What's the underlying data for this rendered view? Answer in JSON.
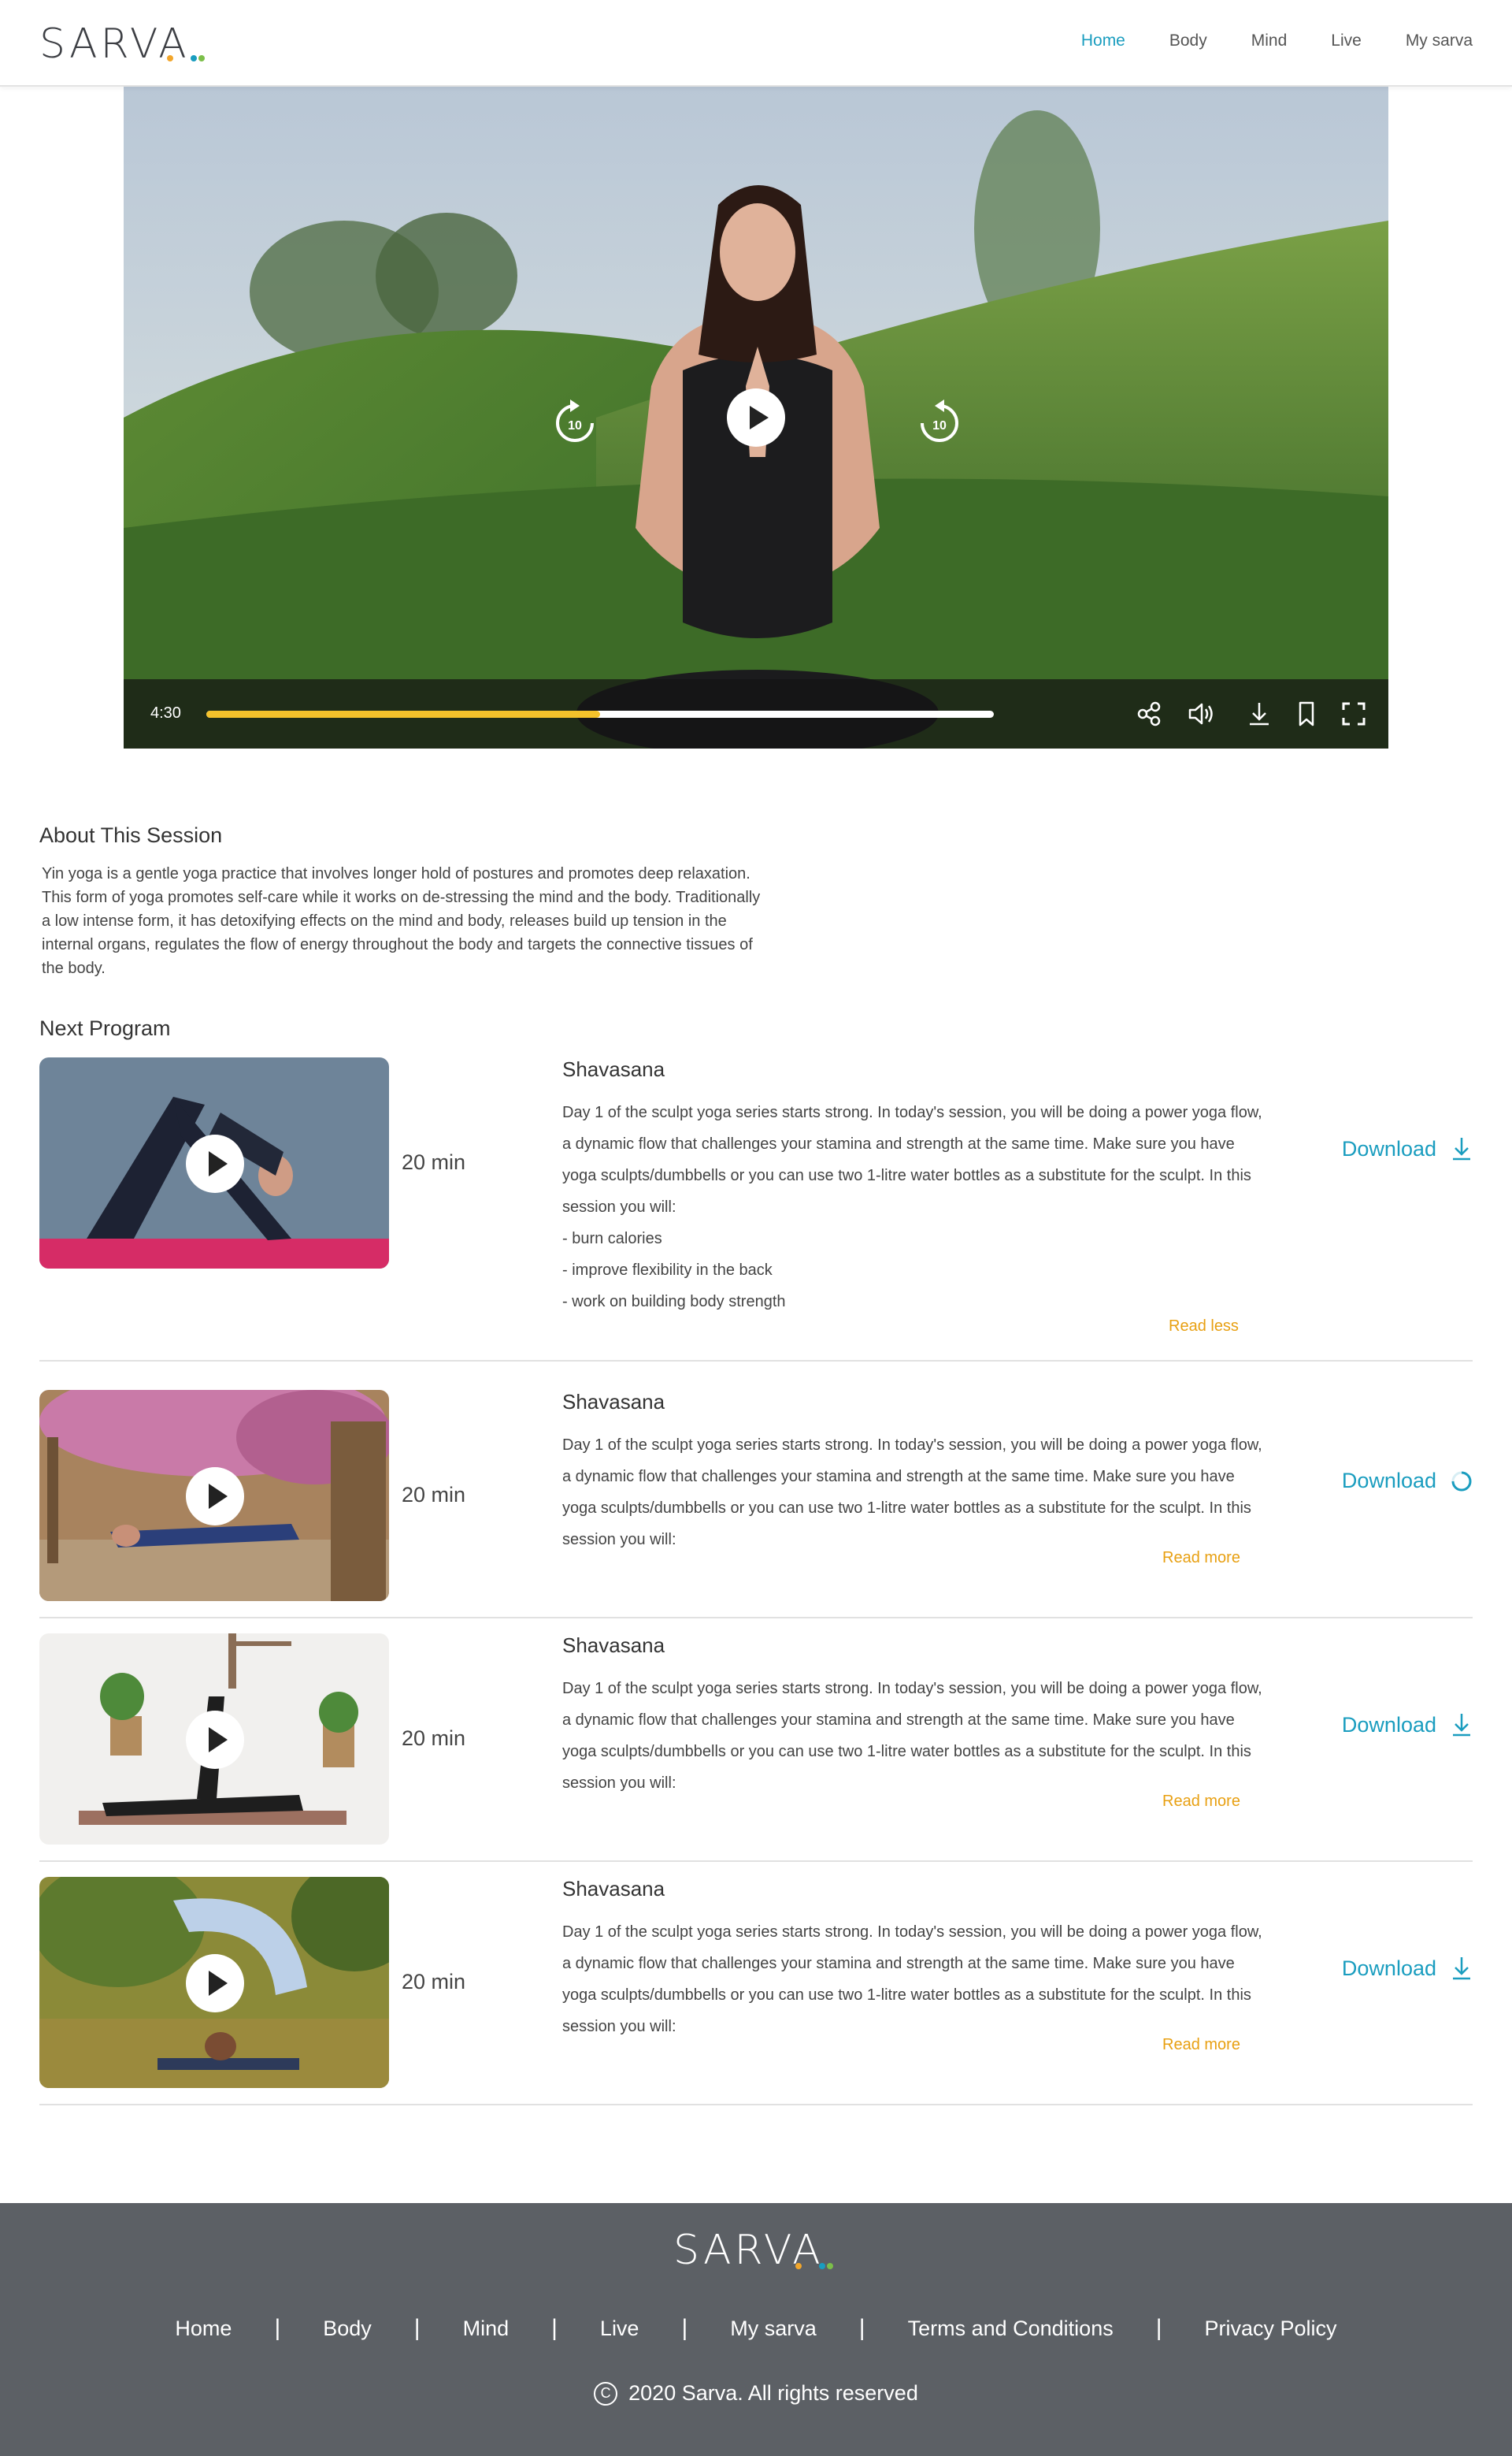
{
  "brand": {
    "logo": "SARVA",
    "colors": {
      "accent": "#1a9dbf",
      "link_orange": "#e8a012",
      "progress": "#f4c22b",
      "footer_bg": "#5c6065"
    }
  },
  "nav": {
    "items": [
      {
        "label": "Home",
        "active": true
      },
      {
        "label": "Body",
        "active": false
      },
      {
        "label": "Mind",
        "active": false
      },
      {
        "label": "Live",
        "active": false
      },
      {
        "label": "My sarva",
        "active": false
      }
    ]
  },
  "player": {
    "current_time": "4:30",
    "progress": 0.5,
    "rewind_label": "10",
    "forward_label": "10",
    "controls": [
      "share-icon",
      "volume-icon",
      "download-icon",
      "bookmark-icon",
      "fullscreen-icon"
    ]
  },
  "about": {
    "title": "About This Session",
    "text": "Yin yoga is a gentle yoga practice that involves longer hold of postures and promotes deep relaxation. This form of yoga promotes self-care while it works on de-stressing the mind and the body. Traditionally a low intense form, it has detoxifying effects on the mind and body, releases build up tension in the internal organs, regulates the flow of energy throughout the body and targets the connective tissues of the body."
  },
  "next_program": {
    "title": "Next Program",
    "items": [
      {
        "title": "Shavasana",
        "duration": "20 min",
        "description": "Day 1 of the sculpt yoga series starts strong. In today's session, you will be doing a power yoga flow, a dynamic flow that challenges your stamina and strength at the same time. Make sure you have yoga sculpts/dumbbells or you can use two 1-litre water bottles as a substitute for the sculpt. In this session you will:",
        "bullets": [
          "- burn calories",
          "- improve flexibility in the back",
          "- work on building body strength"
        ],
        "link": "Read less",
        "download_label": "Download",
        "download_state": "idle"
      },
      {
        "title": "Shavasana",
        "duration": "20 min",
        "description": "Day 1 of the sculpt yoga series starts strong. In today's session, you will be doing a power yoga flow, a dynamic flow that challenges your stamina and strength at the same time. Make sure you have yoga sculpts/dumbbells or you can use two 1-litre water bottles as a substitute for the sculpt. In this session you will:",
        "bullets": [],
        "link": "Read more",
        "download_label": "Download",
        "download_state": "loading"
      },
      {
        "title": "Shavasana",
        "duration": "20 min",
        "description": "Day 1 of the sculpt yoga series starts strong. In today's session, you will be doing a power yoga flow, a dynamic flow that challenges your stamina and strength at the same time. Make sure you have yoga sculpts/dumbbells or you can use two 1-litre water bottles as a substitute for the sculpt. In this session you will:",
        "bullets": [],
        "link": "Read more",
        "download_label": "Download",
        "download_state": "idle"
      },
      {
        "title": "Shavasana",
        "duration": "20 min",
        "description": "Day 1 of the sculpt yoga series starts strong. In today's session, you will be doing a power yoga flow, a dynamic flow that challenges your stamina and strength at the same time. Make sure you have yoga sculpts/dumbbells or you can use two 1-litre water bottles as a substitute for the sculpt. In this session you will:",
        "bullets": [],
        "link": "Read more",
        "download_label": "Download",
        "download_state": "idle"
      }
    ]
  },
  "footer": {
    "logo": "SARVA",
    "links": [
      "Home",
      "Body",
      "Mind",
      "Live",
      "My sarva",
      "Terms and Conditions",
      "Privacy Policy"
    ],
    "separator": "|",
    "copyright_symbol": "C",
    "copyright": "2020 Sarva. All rights reserved"
  }
}
